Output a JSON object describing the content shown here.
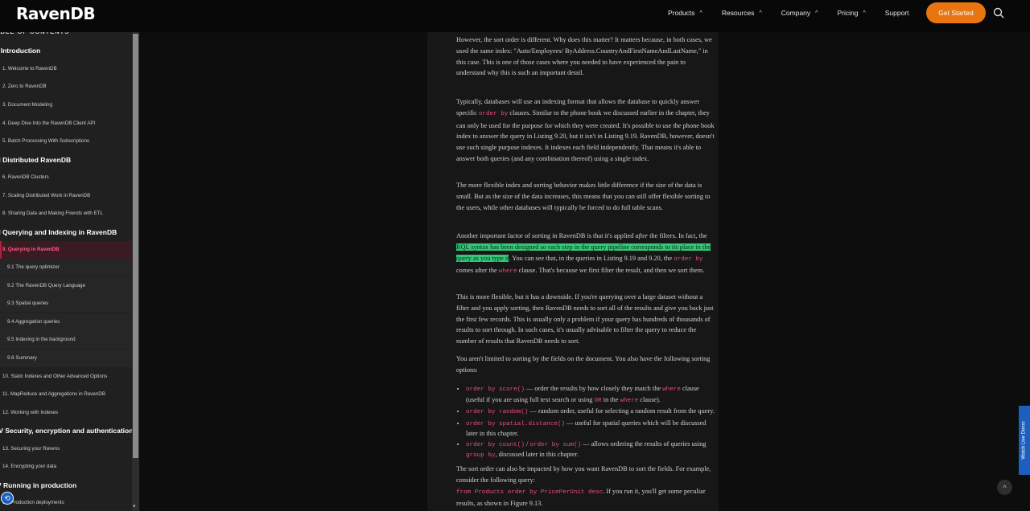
{
  "header": {
    "logo": "RavenDB",
    "nav": [
      {
        "label": "Products",
        "chev": "^"
      },
      {
        "label": "Resources",
        "chev": "^"
      },
      {
        "label": "Company",
        "chev": "^"
      },
      {
        "label": "Pricing",
        "chev": "^"
      },
      {
        "label": "Support",
        "chev": ""
      }
    ],
    "cta": "Get Started",
    "accent": "#e8750f"
  },
  "sidebar": {
    "title": "ABLE OF CONTENTS",
    "parts": {
      "p1": "I Introduction",
      "p2": "II Distributed RavenDB",
      "p3": "II Querying and Indexing in RavenDB",
      "p4": "IV Security, encryption and authentication",
      "p5": "V Running in production"
    },
    "chapters": {
      "c1": "1. Welcome to RavenDB",
      "c2": "2. Zero to RavenDB",
      "c3": "3. Document Modeling",
      "c4": "4. Deep Dive Into the RavenDB Client API",
      "c5": "5. Batch Processing With Subscriptions",
      "c6": "6. RavenDB Clusters",
      "c7": "7. Scaling Distributed Work in RavenDB",
      "c8": "8. Sharing Data and Making Friends with ETL",
      "c9": "9. Querying in RavenDB",
      "c10": "10. Static Indexes and Other Advanced Options",
      "c11": "11. MapReduce and Aggregations in RavenDB",
      "c12": "12. Working with Indexes",
      "c13": "13. Securing your Ravens",
      "c14": "14. Encrypting your data",
      "c15": "15. Production deployments"
    },
    "subs": {
      "s1": "9.1 The query optimizer",
      "s2": "9.2 The RavenDB Query Language",
      "s3": "9.3 Spatial queries",
      "s4": "9.4 Aggregation queries",
      "s5": "9.5 Indexing in the background",
      "s6": "9.6 Summary"
    },
    "active_color": "#ff5b84"
  },
  "article": {
    "p1a": "However, the sort order is different. Why does this matter? It matters because, in both cases, we used the same index: \"Auto/Employees/ ByAddress.CountryAndFirstNameAndLastName,\" in this case. This is one of those cases where you needed to have experienced the pain to understand why this is such an important detail.",
    "p2a": "Typically, databases will use an indexing format that allows the database to quickly answer specific ",
    "p2code": "order by",
    "p2b": " clauses. Similar to the phone book we discussed earlier in the chapter, they can only be used for the purpose for which they were created. It's possible to use the phone book index to answer the query in Listing 9.20, but it isn't in Listing 9.19. RavenDB, however, doesn't use such single purpose indexes. It indexes each field independently. That means it's able to answer both queries (and any combination thereof) using a single index.",
    "p3": "The more flexible index and sorting behavior makes little difference if the size of the data is small. But as the size of the data increases, this means that you can still offer flexible sorting to the users, while other databases will typically be forced to do full table scans.",
    "p4a": "Another important factor of sorting in RavenDB is that it's applied ",
    "p4em": "after",
    "p4b": " the filters. In fact, the ",
    "p4hl": "RQL syntax has been designed so each step in the query pipeline corresponds to its place in the query as you type it",
    "p4c": ". You can see that, in the queries in Listing 9.19 and 9.20, the ",
    "p4code1": "order by",
    "p4d": " comes after the ",
    "p4code2": "where",
    "p4e": " clause. That's because we first filter the result, and then we sort them.",
    "p5": "This is more flexible, but it has a downside. If you're querying over a large dataset without a filter and you apply sorting, then RavenDB needs to sort all of the results and give you back just the first few records. This is usually only a problem if your query has hundreds of thousands of results to sort through. In such cases, it's usually advisable to filter the query to reduce the number of results that RavenDB needs to sort.",
    "p6": "You aren't limited to sorting by the fields on the document. You also have the following sorting options:",
    "li1code": "order by score()",
    "li1a": " — order the results by how closely they match the ",
    "li1code2": "where",
    "li1b": " clause (useful if you are using full text search or using ",
    "li1code3": "OR",
    "li1c": " in the ",
    "li1code4": "where",
    "li1d": " clause).",
    "li2code": "order by random()",
    "li2a": " — random order, useful for selecting a random result from the query.",
    "li3code": "order by spatial.distance()",
    "li3a": " — useful for spatial queries which will be discussed later in this chapter.",
    "li4code": "order by count()",
    "li4sep": " / ",
    "li4code2": "order by sum()",
    "li4a": " — allows ordering the results of queries using ",
    "li4code3": "group by",
    "li4b": ", discussed later in this chapter.",
    "p7a": "The sort order can also be impacted by how you want RavenDB to sort the fields. For example, consider the following query:",
    "p7code": "from Products order by PricePerUnit desc",
    "p7b": ". If you run it, you'll get some peculiar results, as shown in Figure 9.13."
  },
  "widgets": {
    "live_demo": "Watch Live Demo",
    "back_top": "^"
  }
}
